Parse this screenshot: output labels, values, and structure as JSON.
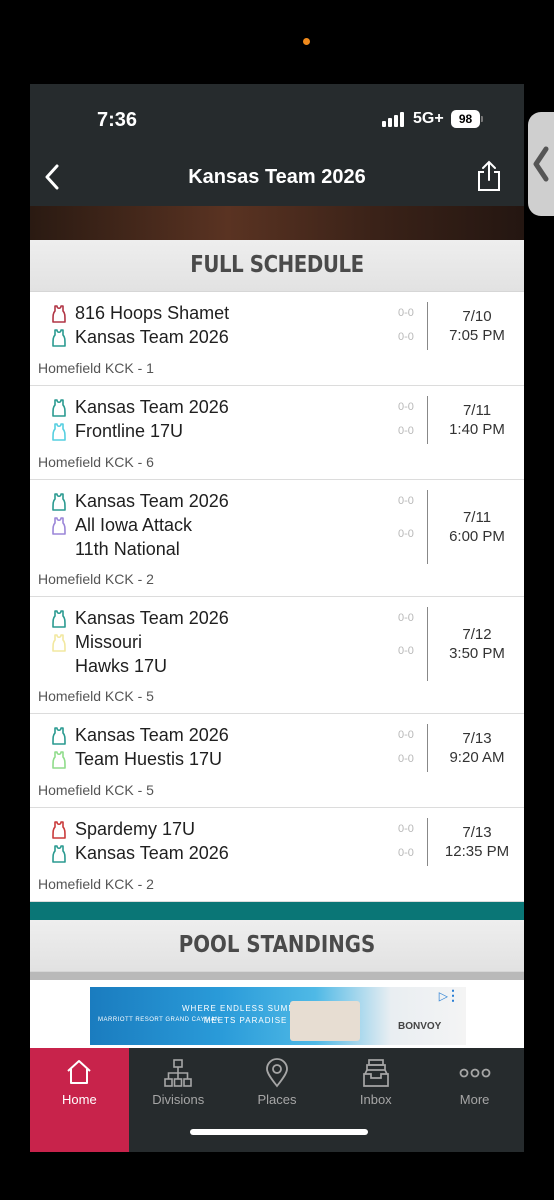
{
  "status": {
    "time": "7:36",
    "network": "5G+",
    "battery": "98"
  },
  "header": {
    "title": "Kansas Team 2026"
  },
  "schedule": {
    "heading": "FULL SCHEDULE",
    "games": [
      {
        "teams": [
          {
            "name": "816 Hoops Shamet",
            "line2": "",
            "score": "0-0",
            "color": "#b13545"
          },
          {
            "name": "Kansas Team 2026",
            "line2": "",
            "score": "0-0",
            "color": "#2a9a90"
          }
        ],
        "date": "7/10",
        "time": "7:05 PM",
        "venue": "Homefield KCK - 1"
      },
      {
        "teams": [
          {
            "name": "Kansas Team 2026",
            "line2": "",
            "score": "0-0",
            "color": "#2a9a90"
          },
          {
            "name": "Frontline 17U",
            "line2": "",
            "score": "0-0",
            "color": "#55cfe0"
          }
        ],
        "date": "7/11",
        "time": "1:40 PM",
        "venue": "Homefield KCK - 6"
      },
      {
        "teams": [
          {
            "name": "Kansas Team 2026",
            "line2": "",
            "score": "0-0",
            "color": "#2a9a90"
          },
          {
            "name": "All Iowa Attack",
            "line2": "11th National",
            "score": "0-0",
            "color": "#9b86d8"
          }
        ],
        "date": "7/11",
        "time": "6:00 PM",
        "venue": "Homefield KCK - 2"
      },
      {
        "teams": [
          {
            "name": "Kansas Team 2026",
            "line2": "",
            "score": "0-0",
            "color": "#2a9a90"
          },
          {
            "name": "Missouri",
            "line2": "Hawks 17U",
            "score": "0-0",
            "color": "#f2e8a0"
          }
        ],
        "date": "7/12",
        "time": "3:50 PM",
        "venue": "Homefield KCK - 5"
      },
      {
        "teams": [
          {
            "name": "Kansas Team 2026",
            "line2": "",
            "score": "0-0",
            "color": "#2a9a90"
          },
          {
            "name": "Team Huestis 17U",
            "line2": "",
            "score": "0-0",
            "color": "#8fdc8a"
          }
        ],
        "date": "7/13",
        "time": "9:20 AM",
        "venue": "Homefield KCK - 5"
      },
      {
        "teams": [
          {
            "name": "Spardemy 17U",
            "line2": "",
            "score": "0-0",
            "color": "#c93a3a"
          },
          {
            "name": "Kansas Team 2026",
            "line2": "",
            "score": "0-0",
            "color": "#2a9a90"
          }
        ],
        "date": "7/13",
        "time": "12:35 PM",
        "venue": "Homefield KCK - 2"
      }
    ]
  },
  "standings": {
    "heading": "POOL STANDINGS"
  },
  "ad": {
    "brand_left": "MARRIOTT RESORT GRAND CAYMAN",
    "tagline_1": "WHERE ENDLESS SUMMER",
    "tagline_2": "MEETS PARADISE",
    "brand_right": "BONVOY"
  },
  "nav": {
    "items": [
      {
        "label": "Home",
        "icon": "home-icon"
      },
      {
        "label": "Divisions",
        "icon": "hierarchy-icon"
      },
      {
        "label": "Places",
        "icon": "location-pin-icon"
      },
      {
        "label": "Inbox",
        "icon": "inbox-tray-icon"
      },
      {
        "label": "More",
        "icon": "more-dots-icon"
      }
    ]
  }
}
